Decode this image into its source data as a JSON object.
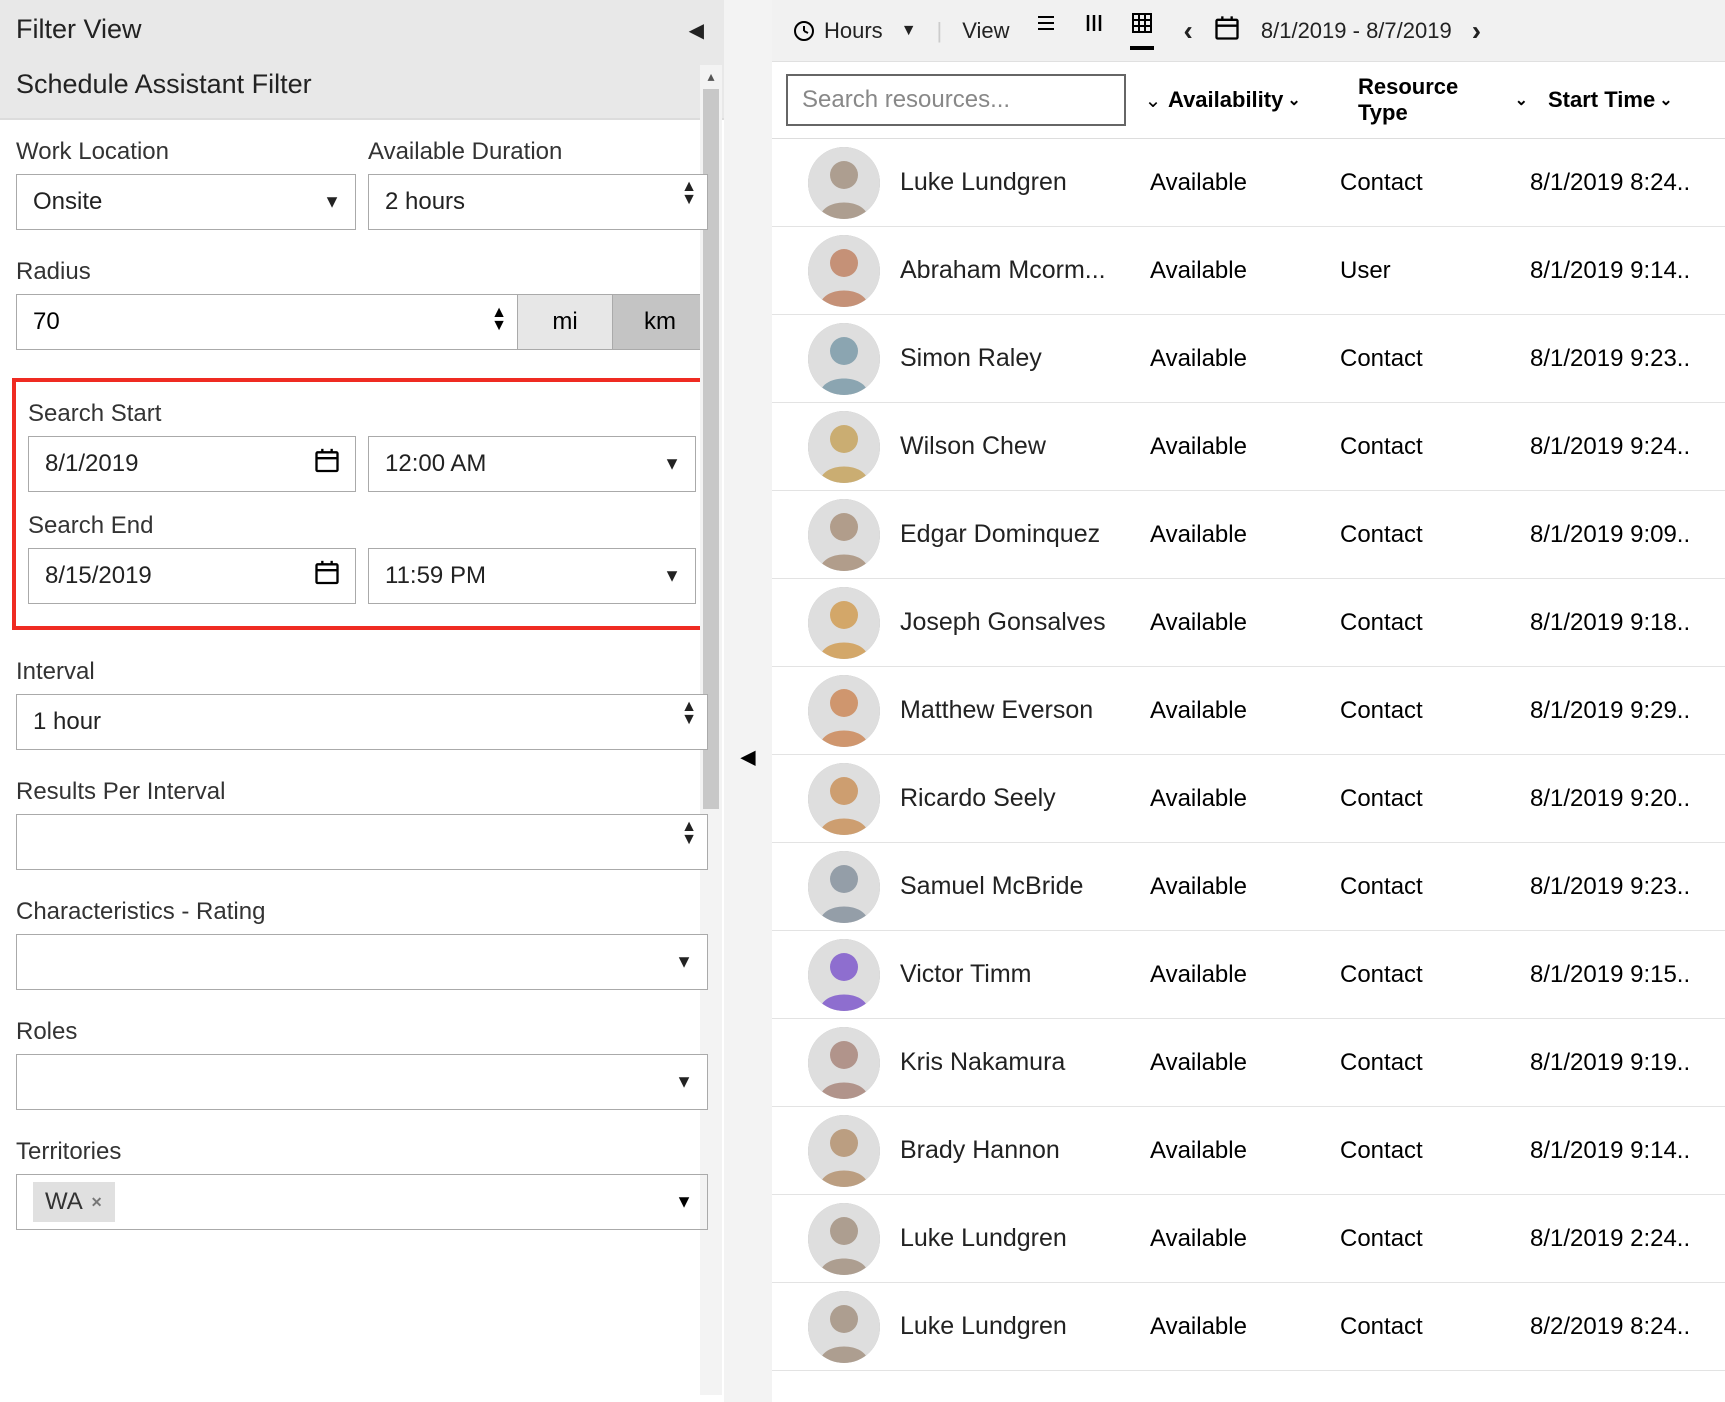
{
  "headers": {
    "filter_view": "Filter View",
    "schedule_assistant": "Schedule Assistant Filter"
  },
  "labels": {
    "work_location": "Work Location",
    "available_duration": "Available Duration",
    "radius": "Radius",
    "search_start": "Search Start",
    "search_end": "Search End",
    "interval": "Interval",
    "results_per_interval": "Results Per Interval",
    "characteristics": "Characteristics - Rating",
    "roles": "Roles",
    "territories": "Territories"
  },
  "values": {
    "work_location": "Onsite",
    "available_duration": "2 hours",
    "radius": "70",
    "unit_mi": "mi",
    "unit_km": "km",
    "search_start_date": "8/1/2019",
    "search_start_time": "12:00 AM",
    "search_end_date": "8/15/2019",
    "search_end_time": "11:59 PM",
    "interval": "1 hour",
    "results_per_interval": "",
    "characteristics": "",
    "roles": "",
    "territory_tag": "WA"
  },
  "toolbar": {
    "hours": "Hours",
    "view": "View",
    "date_range": "8/1/2019 - 8/7/2019"
  },
  "columns": {
    "search_placeholder": "Search resources...",
    "availability": "Availability",
    "resource_type": "Resource Type",
    "start_time": "Start Time"
  },
  "rows": [
    {
      "name": "Luke Lundgren",
      "availability": "Available",
      "type": "Contact",
      "start": "8/1/2019 8:24..",
      "hue": 30,
      "sat": 15
    },
    {
      "name": "Abraham Mcorm...",
      "availability": "Available",
      "type": "User",
      "start": "8/1/2019 9:14..",
      "hue": 20,
      "sat": 40
    },
    {
      "name": "Simon Raley",
      "availability": "Available",
      "type": "Contact",
      "start": "8/1/2019 9:23..",
      "hue": 200,
      "sat": 20
    },
    {
      "name": "Wilson Chew",
      "availability": "Available",
      "type": "Contact",
      "start": "8/1/2019 9:24..",
      "hue": 40,
      "sat": 45
    },
    {
      "name": "Edgar Dominquez",
      "availability": "Available",
      "type": "Contact",
      "start": "8/1/2019 9:09..",
      "hue": 28,
      "sat": 20
    },
    {
      "name": "Joseph Gonsalves",
      "availability": "Available",
      "type": "Contact",
      "start": "8/1/2019 9:18..",
      "hue": 35,
      "sat": 55
    },
    {
      "name": "Matthew Everson",
      "availability": "Available",
      "type": "Contact",
      "start": "8/1/2019 9:29..",
      "hue": 25,
      "sat": 50
    },
    {
      "name": "Ricardo Seely",
      "availability": "Available",
      "type": "Contact",
      "start": "8/1/2019 9:20..",
      "hue": 30,
      "sat": 48
    },
    {
      "name": "Samuel McBride",
      "availability": "Available",
      "type": "Contact",
      "start": "8/1/2019 9:23..",
      "hue": 210,
      "sat": 10
    },
    {
      "name": "Victor Timm",
      "availability": "Available",
      "type": "Contact",
      "start": "8/1/2019 9:15..",
      "hue": 260,
      "sat": 50
    },
    {
      "name": "Kris Nakamura",
      "availability": "Available",
      "type": "Contact",
      "start": "8/1/2019 9:19..",
      "hue": 15,
      "sat": 20
    },
    {
      "name": "Brady Hannon",
      "availability": "Available",
      "type": "Contact",
      "start": "8/1/2019 9:14..",
      "hue": 30,
      "sat": 30
    },
    {
      "name": "Luke Lundgren",
      "availability": "Available",
      "type": "Contact",
      "start": "8/1/2019 2:24..",
      "hue": 30,
      "sat": 15
    },
    {
      "name": "Luke Lundgren",
      "availability": "Available",
      "type": "Contact",
      "start": "8/2/2019 8:24..",
      "hue": 30,
      "sat": 15
    }
  ]
}
